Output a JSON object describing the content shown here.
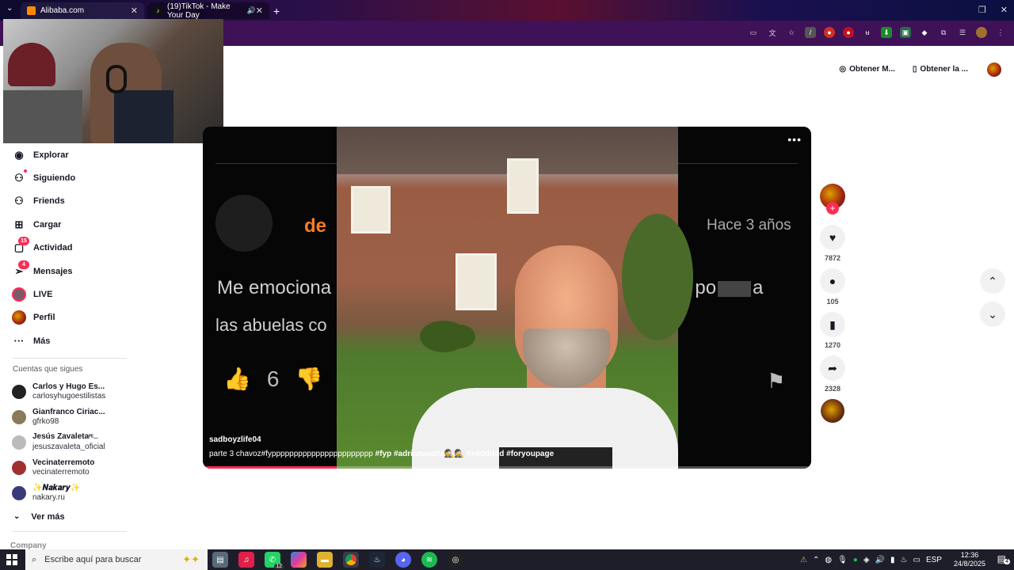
{
  "browser": {
    "tabs": [
      {
        "title": "Alibaba.com",
        "active": false
      },
      {
        "title": "(19)TikTok - Make Your Day",
        "active": true
      }
    ],
    "new_tab": "+"
  },
  "header": {
    "get_coins": "Obtener M...",
    "get_app": "Obtener la ..."
  },
  "sidebar": {
    "nav": [
      {
        "label": "Explorar"
      },
      {
        "label": "Siguiendo"
      },
      {
        "label": "Friends"
      },
      {
        "label": "Cargar"
      },
      {
        "label": "Actividad",
        "badge": "15"
      },
      {
        "label": "Mensajes",
        "badge": "4"
      },
      {
        "label": "LIVE"
      },
      {
        "label": "Perfil"
      },
      {
        "label": "Más"
      }
    ],
    "following_title": "Cuentas que sigues",
    "following": [
      {
        "name": "Carlos y Hugo Es...",
        "handle": "carlosyhugoestilistas"
      },
      {
        "name": "Gianfranco Ciriac...",
        "handle": "gfrko98"
      },
      {
        "name": "Jesús Zavaleta",
        "suffix": "ᴾᴱ...",
        "handle": "jesuszavaleta_oficial"
      },
      {
        "name": "Vecinaterremoto",
        "handle": "vecinaterremoto"
      },
      {
        "name": "✨𝑵𝒂𝒌𝒂𝒓𝒚✨",
        "handle": "nakary.ru"
      }
    ],
    "see_more": "Ver más",
    "company": "Company"
  },
  "video": {
    "overlay": {
      "channel_partial": "de",
      "time_ago": "Hace 3 años",
      "line1_left": "Me emociona",
      "line1_right": "el po",
      "line1_end": "a",
      "line2_left": "las abuelas co",
      "likes": "6"
    },
    "author": "sadboyzlife04",
    "description": "parte 3 chavoz#fyppppppppppppppppppppppp",
    "hashtags": [
      "#fyp",
      "#adrianasalte🕵🕵",
      "#xdddddd",
      "#foryoupage"
    ],
    "progress": 0.22
  },
  "actions": {
    "likes": "7872",
    "comments": "105",
    "saves": "1270",
    "shares": "2328"
  },
  "taskbar": {
    "search_placeholder": "Escribe aquí para buscar",
    "whatsapp_count": "12",
    "language": "ESP",
    "time": "12:36",
    "date": "24/8/2025",
    "notifications": "4"
  }
}
